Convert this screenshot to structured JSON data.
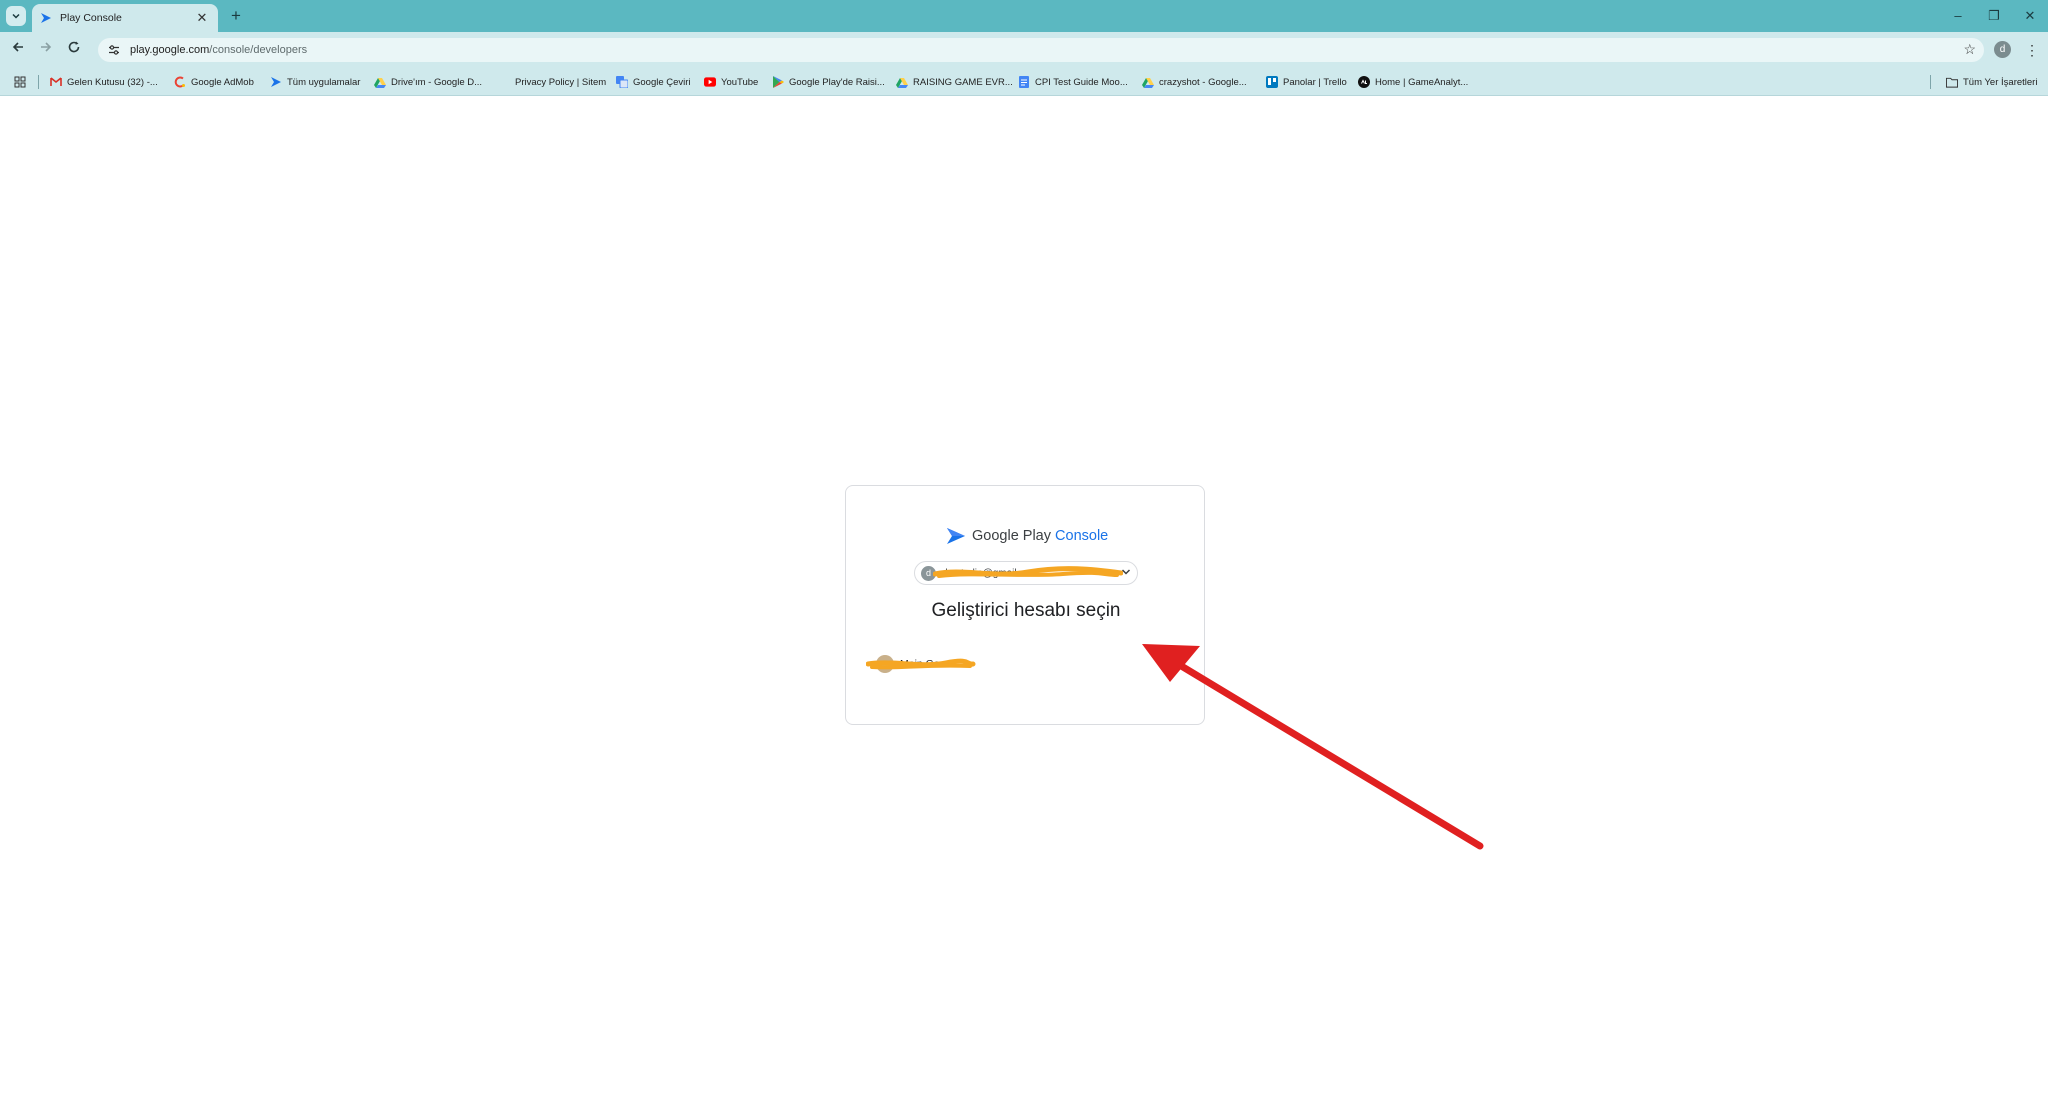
{
  "browser": {
    "tab": {
      "title": "Play Console"
    },
    "new_tab_label": "+",
    "window_controls": {
      "minimize": "–",
      "restore": "❐",
      "close": "✕"
    },
    "url": {
      "host": "play.google.com",
      "path": "/console/developers"
    },
    "profile_initial": "d",
    "bookmarks": [
      {
        "label": "Gelen Kutusu (32) -...",
        "icon": "gmail-icon"
      },
      {
        "label": "Google AdMob",
        "icon": "admob-icon"
      },
      {
        "label": "Tüm uygulamalar",
        "icon": "play-console-icon"
      },
      {
        "label": "Drive'ım - Google D...",
        "icon": "drive-icon"
      },
      {
        "label": "Privacy Policy | Sitem",
        "icon": ""
      },
      {
        "label": "Google Çeviri",
        "icon": "translate-icon"
      },
      {
        "label": "YouTube",
        "icon": "youtube-icon"
      },
      {
        "label": "Google Play'de Raisi...",
        "icon": "google-play-icon"
      },
      {
        "label": "RAISING GAME EVR...",
        "icon": "drive-icon"
      },
      {
        "label": "CPI Test Guide Moo...",
        "icon": "docs-icon"
      },
      {
        "label": "crazyshot - Google...",
        "icon": "drive-icon"
      },
      {
        "label": "Panolar | Trello",
        "icon": "trello-icon"
      },
      {
        "label": "Home | GameAnalyt...",
        "icon": "gameanalytics-icon"
      }
    ],
    "all_bookmarks_label": "Tüm Yer İşaretleri"
  },
  "page": {
    "logo": {
      "brand": "Google Play",
      "product": "Console"
    },
    "account": {
      "initial": "d",
      "email": "d...studio@gmail.com"
    },
    "heading": "Geliştirici hesabı seçin",
    "developers": [
      {
        "name": "Main Game"
      }
    ]
  },
  "colors": {
    "titlebar": "#5bb8c1",
    "toolbar": "#cfe9ec",
    "accent": "#1a73e8",
    "arrow": "#e02020",
    "redaction": "#f5a623"
  }
}
